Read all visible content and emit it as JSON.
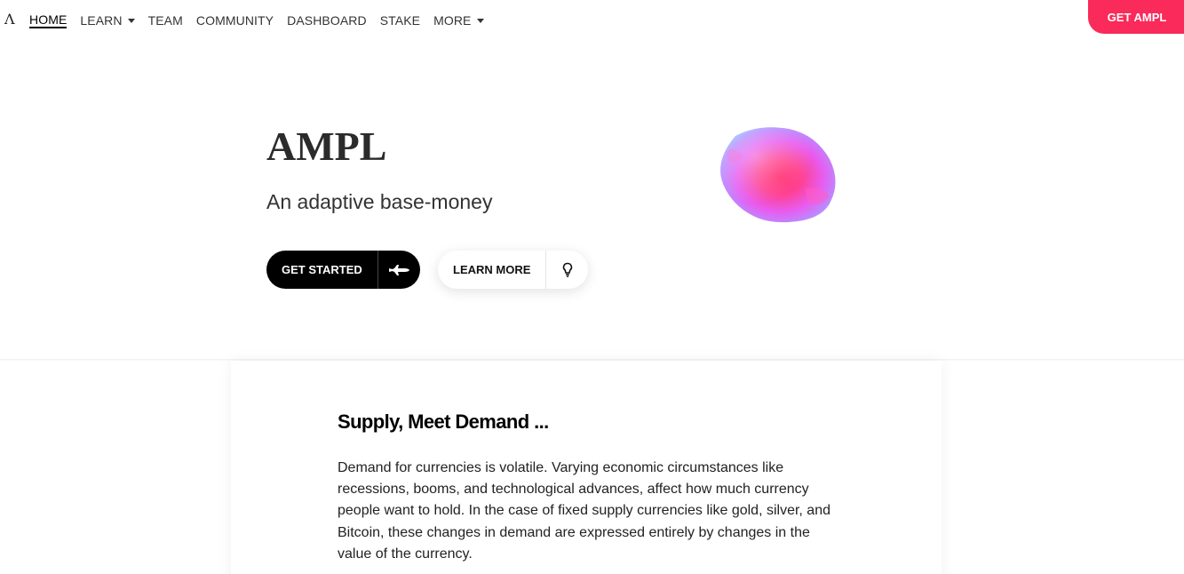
{
  "nav": {
    "logo": "Λ",
    "items": [
      {
        "label": "HOME",
        "active": true,
        "dropdown": false
      },
      {
        "label": "LEARN",
        "active": false,
        "dropdown": true
      },
      {
        "label": "TEAM",
        "active": false,
        "dropdown": false
      },
      {
        "label": "COMMUNITY",
        "active": false,
        "dropdown": false
      },
      {
        "label": "DASHBOARD",
        "active": false,
        "dropdown": false
      },
      {
        "label": "STAKE",
        "active": false,
        "dropdown": false
      },
      {
        "label": "MORE",
        "active": false,
        "dropdown": true
      }
    ],
    "cta_label": "GET AMPL"
  },
  "hero": {
    "title": "AMPL",
    "subtitle": "An adaptive base-money",
    "primary_button": {
      "label": "GET STARTED",
      "icon": "rocket-icon"
    },
    "secondary_button": {
      "label": "LEARN MORE",
      "icon": "lightbulb-icon"
    }
  },
  "section": {
    "title": "Supply, Meet Demand ...",
    "body": "Demand for currencies is volatile. Varying economic circumstances like recessions, booms, and technological advances, affect how much currency people want to hold. In the case of fixed supply currencies like gold, silver, and Bitcoin, these changes in demand are expressed entirely by changes in the value of the currency."
  },
  "colors": {
    "accent": "#fa2a5a",
    "primary_button_bg": "#000000",
    "text": "#2b2b2b"
  }
}
